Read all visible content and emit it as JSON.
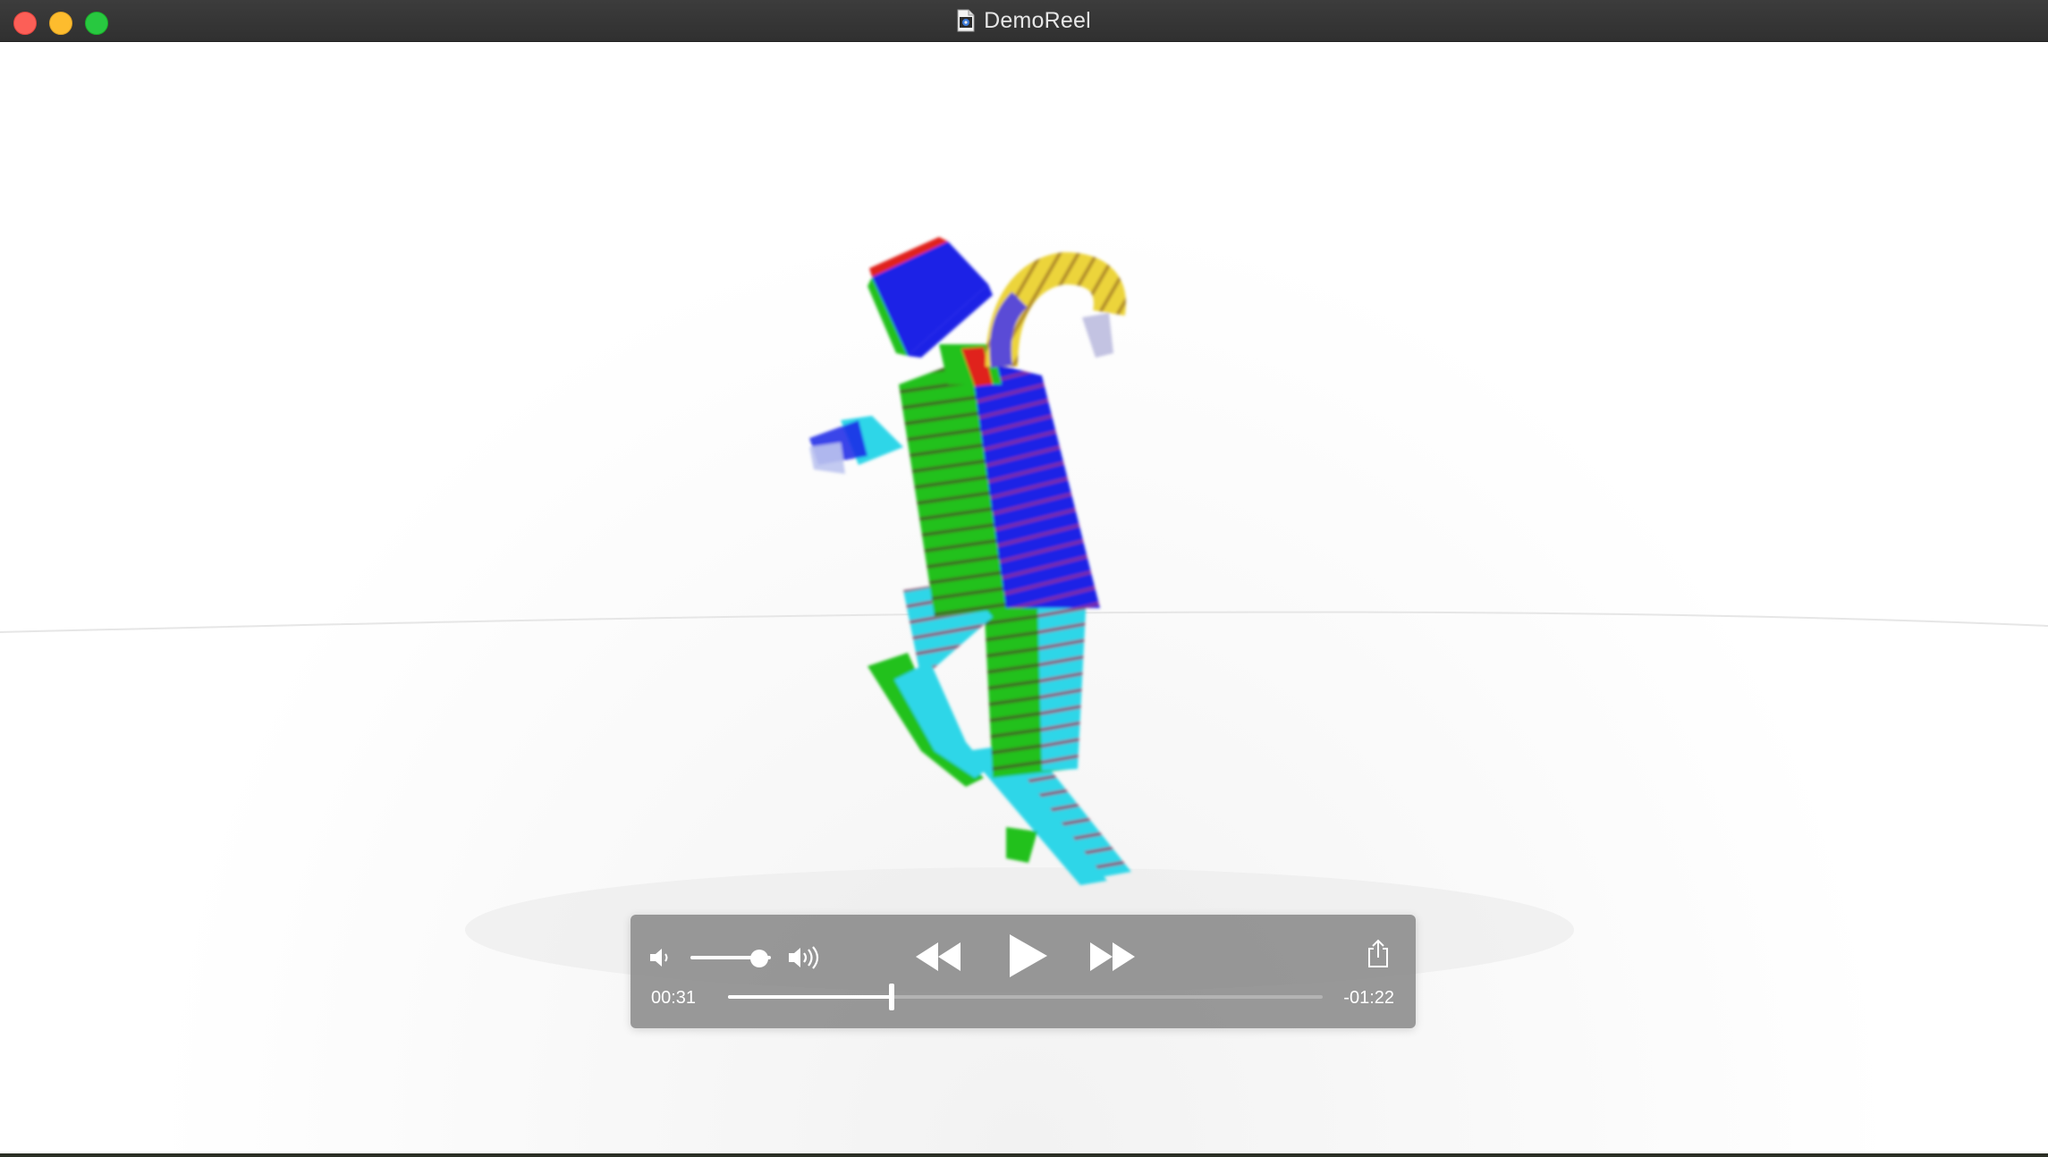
{
  "window": {
    "title": "DemoReel",
    "title_icon": "quicktime-document-icon",
    "traffic_lights": [
      "close",
      "minimize",
      "zoom"
    ]
  },
  "player": {
    "elapsed": "00:31",
    "remaining": "-01:22",
    "progress_fraction": 0.275,
    "volume_fraction": 0.85,
    "controls": [
      "volume-mute-icon",
      "volume-slider",
      "volume-loud-icon",
      "rewind-icon",
      "play-icon",
      "fast-forward-icon",
      "share-icon"
    ]
  },
  "colors": {
    "titlebar": "#363636",
    "hud": "#828282",
    "accent_green": "#28c840",
    "accent_yellow": "#fdbc2e",
    "accent_red": "#fc5f57"
  }
}
